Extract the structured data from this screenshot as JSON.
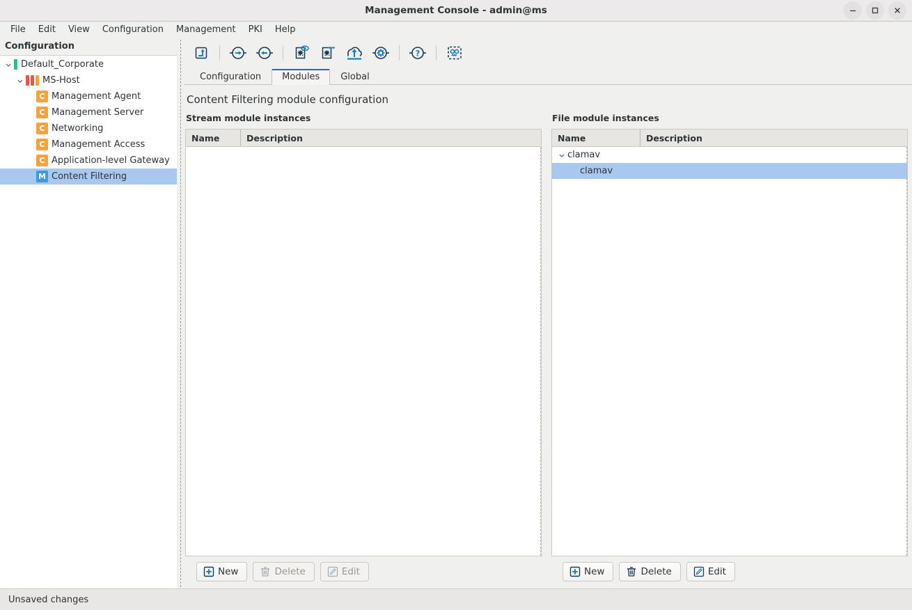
{
  "window": {
    "title": "Management Console - admin@ms",
    "controls": [
      {
        "name": "minimize",
        "glyph": "—"
      },
      {
        "name": "maximize",
        "glyph": "□"
      },
      {
        "name": "close",
        "glyph": "✕"
      }
    ]
  },
  "menubar": {
    "items": [
      "File",
      "Edit",
      "View",
      "Configuration",
      "Management",
      "PKI",
      "Help"
    ]
  },
  "sidebar": {
    "header": "Configuration",
    "tree": [
      {
        "label": "Default_Corporate",
        "icon": "single-green-bar-icon",
        "indent": 0,
        "twisty": "down",
        "selected": false
      },
      {
        "label": "MS-Host",
        "icon": "triple-bar-icon",
        "indent": 1,
        "twisty": "down",
        "selected": false
      },
      {
        "label": "Management Agent",
        "icon": "c-badge-icon",
        "badge": "C",
        "indent": 2,
        "twisty": "none",
        "selected": false
      },
      {
        "label": "Management Server",
        "icon": "c-badge-icon",
        "badge": "C",
        "indent": 2,
        "twisty": "none",
        "selected": false
      },
      {
        "label": "Networking",
        "icon": "c-badge-icon",
        "badge": "C",
        "indent": 2,
        "twisty": "none",
        "selected": false
      },
      {
        "label": "Management Access",
        "icon": "c-badge-icon",
        "badge": "C",
        "indent": 2,
        "twisty": "none",
        "selected": false
      },
      {
        "label": "Application-level Gateway",
        "icon": "c-badge-icon",
        "badge": "C",
        "indent": 2,
        "twisty": "none",
        "selected": false
      },
      {
        "label": "Content Filtering",
        "icon": "m-badge-icon",
        "badge": "M",
        "indent": 2,
        "twisty": "none",
        "selected": true
      }
    ]
  },
  "toolbar": {
    "buttons": [
      {
        "name": "go-up-icon",
        "tooltip": "Up"
      },
      {
        "name": "arrow-right-in-circle-icon",
        "tooltip": "Forward"
      },
      {
        "name": "arrow-left-in-circle-icon",
        "tooltip": "Back"
      },
      {
        "name": "config-preview-eye-icon",
        "tooltip": "Preview configuration"
      },
      {
        "name": "config-transfer-icon",
        "tooltip": "Transfer configuration"
      },
      {
        "name": "upload-cloud-icon",
        "tooltip": "Upload"
      },
      {
        "name": "gear-in-circle-icon",
        "tooltip": "Settings"
      },
      {
        "name": "question-in-circle-icon",
        "tooltip": "Help"
      },
      {
        "name": "robot-icon",
        "tooltip": "Assistant"
      }
    ]
  },
  "tabs": [
    {
      "label": "Configuration",
      "active": false
    },
    {
      "label": "Modules",
      "active": true
    },
    {
      "label": "Global",
      "active": false
    }
  ],
  "page": {
    "title": "Content Filtering module configuration"
  },
  "stream_panel": {
    "title": "Stream module instances",
    "columns": [
      "Name",
      "Description"
    ],
    "rows": [],
    "buttons": [
      {
        "label": "New",
        "icon": "plus-box-icon",
        "enabled": true
      },
      {
        "label": "Delete",
        "icon": "trash-icon",
        "enabled": false
      },
      {
        "label": "Edit",
        "icon": "pencil-icon",
        "enabled": false
      }
    ]
  },
  "file_panel": {
    "title": "File module instances",
    "columns": [
      "Name",
      "Description"
    ],
    "rows": [
      {
        "name": "clamav",
        "description": "",
        "indent": 0,
        "twisty": "down",
        "selected": false
      },
      {
        "name": "clamav",
        "description": "",
        "indent": 1,
        "twisty": "none",
        "selected": true
      }
    ],
    "buttons": [
      {
        "label": "New",
        "icon": "plus-box-icon",
        "enabled": true
      },
      {
        "label": "Delete",
        "icon": "trash-icon",
        "enabled": true
      },
      {
        "label": "Edit",
        "icon": "pencil-icon",
        "enabled": true
      }
    ]
  },
  "statusbar": {
    "text": "Unsaved changes"
  },
  "colors": {
    "accent": "#1b6acb",
    "selection": "#a8c8ef",
    "badge_config": "#f5a33c",
    "badge_module": "#3c9ae0",
    "bar_green": "#26c08a",
    "bar_red": "#e8564a",
    "bar_orange": "#f5a33c",
    "icon_dark": "#1a3a52",
    "icon_blue": "#1d7fb8"
  }
}
